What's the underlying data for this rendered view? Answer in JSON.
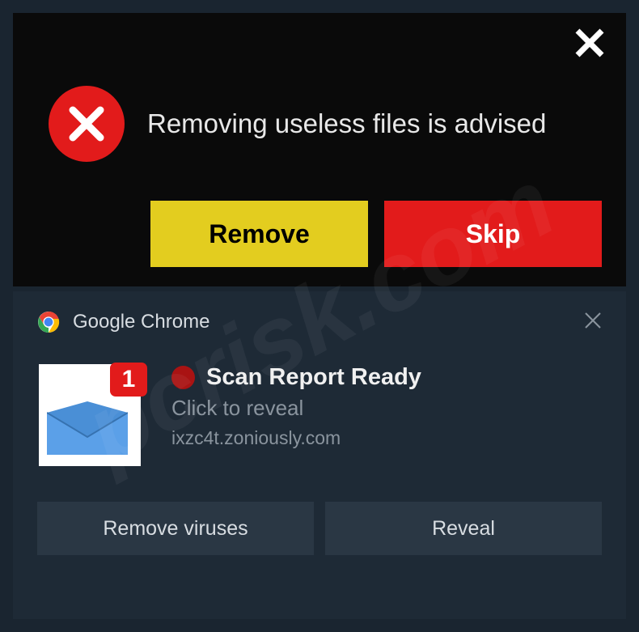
{
  "top_popup": {
    "message": "Removing useless files is advised",
    "remove_label": "Remove",
    "skip_label": "Skip"
  },
  "notification": {
    "app_name": "Google Chrome",
    "badge_count": "1",
    "title": "Scan Report Ready",
    "subtitle": "Click to reveal",
    "domain": "ixzc4t.zoniously.com",
    "button_remove_viruses": "Remove viruses",
    "button_reveal": "Reveal"
  },
  "watermark": "pcrisk.com"
}
